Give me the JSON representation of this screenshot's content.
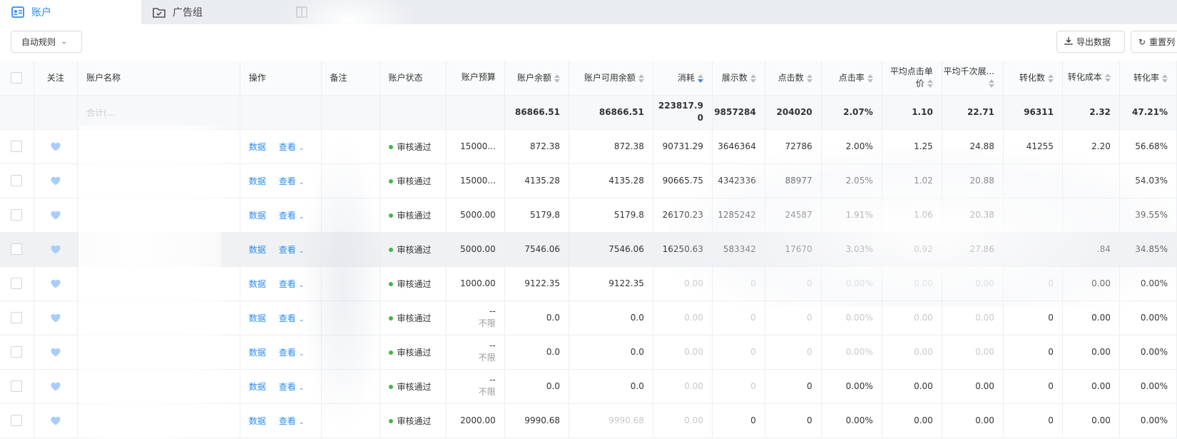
{
  "tabs": [
    {
      "label": "账户"
    },
    {
      "label": "广告组"
    },
    {
      "label": ""
    }
  ],
  "toolbar": {
    "rules_label": "自动规则",
    "export_label": "导出数据",
    "reset_label": "重置列"
  },
  "columns": [
    "关注",
    "账户名称",
    "操作",
    "备注",
    "账户状态",
    "账户预算",
    "账户余额",
    "账户可用余额",
    "消耗",
    "展示数",
    "点击数",
    "点击率",
    "平均点击单价",
    "平均千次展...",
    "转化数",
    "转化成本",
    "转化率"
  ],
  "total": {
    "name": "合计(...",
    "balance": "86866.51",
    "avail": "86866.51",
    "cost": "223817.90",
    "impressions": "9857284",
    "clicks": "204020",
    "ctr": "2.07%",
    "cpc": "1.10",
    "cpm": "22.71",
    "conv": "96311",
    "conv_cost": "2.32",
    "conv_rate": "47.21%"
  },
  "row_actions": {
    "data": "数据",
    "view": "查看"
  },
  "rows": [
    {
      "status": "审核通过",
      "budget": "15000...",
      "budget2": "",
      "balance": "872.38",
      "avail": "872.38",
      "cost": "90731.29",
      "impressions": "3646364",
      "clicks": "72786",
      "ctr": "2.00%",
      "cpc": "1.25",
      "cpm": "24.88",
      "conv": "41255",
      "conv_cost": "2.20",
      "conv_rate": "56.68%"
    },
    {
      "status": "审核通过",
      "budget": "15000...",
      "budget2": "",
      "balance": "4135.28",
      "avail": "4135.28",
      "cost": "90665.75",
      "impressions": "4342336",
      "clicks": "88977",
      "ctr": "2.05%",
      "cpc": "1.02",
      "cpm": "20.88",
      "conv": "",
      "conv_cost": "",
      "conv_rate": "54.03%"
    },
    {
      "status": "审核通过",
      "budget": "5000.00",
      "budget2": "",
      "balance": "5179.8",
      "avail": "5179.8",
      "cost": "26170.23",
      "impressions": "1285242",
      "clicks": "24587",
      "ctr": "1.91%",
      "cpc": "1.06",
      "cpm": "20.38",
      "conv": "",
      "conv_cost": "",
      "conv_rate": "39.55%"
    },
    {
      "status": "审核通过",
      "budget": "5000.00",
      "budget2": "",
      "balance": "7546.06",
      "avail": "7546.06",
      "cost": "16250.63",
      "impressions": "583342",
      "clicks": "17670",
      "ctr": "3.03%",
      "cpc": "0.92",
      "cpm": "27.86",
      "conv": "",
      "conv_cost": ".84",
      "conv_rate": "34.85%"
    },
    {
      "status": "审核通过",
      "budget": "1000.00",
      "budget2": "",
      "balance": "9122.35",
      "avail": "9122.35",
      "cost": "0.00",
      "impressions": "0",
      "clicks": "0",
      "ctr": "0.00%",
      "cpc": "0.00",
      "cpm": "0.00",
      "conv": "0",
      "conv_cost": "0.00",
      "conv_rate": "0.00%"
    },
    {
      "status": "审核通过",
      "budget": "--",
      "budget2": "不限",
      "balance": "0.0",
      "avail": "0.0",
      "cost": "0.00",
      "impressions": "0",
      "clicks": "0",
      "ctr": "0.00%",
      "cpc": "0.00",
      "cpm": "0.00",
      "conv": "0",
      "conv_cost": "0.00",
      "conv_rate": "0.00%"
    },
    {
      "status": "审核通过",
      "budget": "--",
      "budget2": "不限",
      "balance": "0.0",
      "avail": "0.0",
      "cost": "0.00",
      "impressions": "0",
      "clicks": "0",
      "ctr": "0.00%",
      "cpc": "0.00",
      "cpm": "0.00",
      "conv": "0",
      "conv_cost": "0.00",
      "conv_rate": "0.00%"
    },
    {
      "status": "审核通过",
      "budget": "--",
      "budget2": "不限",
      "balance": "0.0",
      "avail": "0.0",
      "cost": "0.00",
      "impressions": "0",
      "clicks": "0",
      "ctr": "0.00%",
      "cpc": "0.00",
      "cpm": "0.00",
      "conv": "0",
      "conv_cost": "0.00",
      "conv_rate": "0.00%"
    },
    {
      "status": "审核通过",
      "budget": "2000.00",
      "budget2": "",
      "balance": "9990.68",
      "avail": "9990.68",
      "cost": "0.00",
      "impressions": "0",
      "clicks": "0",
      "ctr": "0.00%",
      "cpc": "0.00",
      "cpm": "0.00",
      "conv": "0",
      "conv_cost": "0.00",
      "conv_rate": "0.00%"
    }
  ],
  "colors": {
    "accent": "#2d8cf0",
    "status_ok": "#43b548",
    "heart": "#a9cdfa"
  },
  "icons": {
    "account_tab": "account-card-icon",
    "adgroup_tab": "folder-check-icon",
    "export": "download-icon",
    "reset": "refresh-icon"
  }
}
